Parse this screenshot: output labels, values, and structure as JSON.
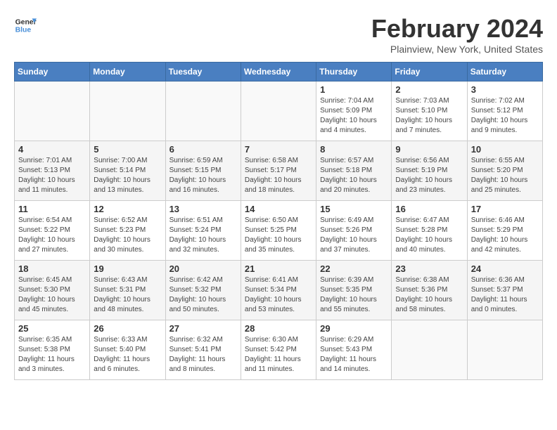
{
  "header": {
    "logo_line1": "General",
    "logo_line2": "Blue",
    "month_year": "February 2024",
    "location": "Plainview, New York, United States"
  },
  "days_of_week": [
    "Sunday",
    "Monday",
    "Tuesday",
    "Wednesday",
    "Thursday",
    "Friday",
    "Saturday"
  ],
  "weeks": [
    [
      {
        "num": "",
        "info": ""
      },
      {
        "num": "",
        "info": ""
      },
      {
        "num": "",
        "info": ""
      },
      {
        "num": "",
        "info": ""
      },
      {
        "num": "1",
        "info": "Sunrise: 7:04 AM\nSunset: 5:09 PM\nDaylight: 10 hours\nand 4 minutes."
      },
      {
        "num": "2",
        "info": "Sunrise: 7:03 AM\nSunset: 5:10 PM\nDaylight: 10 hours\nand 7 minutes."
      },
      {
        "num": "3",
        "info": "Sunrise: 7:02 AM\nSunset: 5:12 PM\nDaylight: 10 hours\nand 9 minutes."
      }
    ],
    [
      {
        "num": "4",
        "info": "Sunrise: 7:01 AM\nSunset: 5:13 PM\nDaylight: 10 hours\nand 11 minutes."
      },
      {
        "num": "5",
        "info": "Sunrise: 7:00 AM\nSunset: 5:14 PM\nDaylight: 10 hours\nand 13 minutes."
      },
      {
        "num": "6",
        "info": "Sunrise: 6:59 AM\nSunset: 5:15 PM\nDaylight: 10 hours\nand 16 minutes."
      },
      {
        "num": "7",
        "info": "Sunrise: 6:58 AM\nSunset: 5:17 PM\nDaylight: 10 hours\nand 18 minutes."
      },
      {
        "num": "8",
        "info": "Sunrise: 6:57 AM\nSunset: 5:18 PM\nDaylight: 10 hours\nand 20 minutes."
      },
      {
        "num": "9",
        "info": "Sunrise: 6:56 AM\nSunset: 5:19 PM\nDaylight: 10 hours\nand 23 minutes."
      },
      {
        "num": "10",
        "info": "Sunrise: 6:55 AM\nSunset: 5:20 PM\nDaylight: 10 hours\nand 25 minutes."
      }
    ],
    [
      {
        "num": "11",
        "info": "Sunrise: 6:54 AM\nSunset: 5:22 PM\nDaylight: 10 hours\nand 27 minutes."
      },
      {
        "num": "12",
        "info": "Sunrise: 6:52 AM\nSunset: 5:23 PM\nDaylight: 10 hours\nand 30 minutes."
      },
      {
        "num": "13",
        "info": "Sunrise: 6:51 AM\nSunset: 5:24 PM\nDaylight: 10 hours\nand 32 minutes."
      },
      {
        "num": "14",
        "info": "Sunrise: 6:50 AM\nSunset: 5:25 PM\nDaylight: 10 hours\nand 35 minutes."
      },
      {
        "num": "15",
        "info": "Sunrise: 6:49 AM\nSunset: 5:26 PM\nDaylight: 10 hours\nand 37 minutes."
      },
      {
        "num": "16",
        "info": "Sunrise: 6:47 AM\nSunset: 5:28 PM\nDaylight: 10 hours\nand 40 minutes."
      },
      {
        "num": "17",
        "info": "Sunrise: 6:46 AM\nSunset: 5:29 PM\nDaylight: 10 hours\nand 42 minutes."
      }
    ],
    [
      {
        "num": "18",
        "info": "Sunrise: 6:45 AM\nSunset: 5:30 PM\nDaylight: 10 hours\nand 45 minutes."
      },
      {
        "num": "19",
        "info": "Sunrise: 6:43 AM\nSunset: 5:31 PM\nDaylight: 10 hours\nand 48 minutes."
      },
      {
        "num": "20",
        "info": "Sunrise: 6:42 AM\nSunset: 5:32 PM\nDaylight: 10 hours\nand 50 minutes."
      },
      {
        "num": "21",
        "info": "Sunrise: 6:41 AM\nSunset: 5:34 PM\nDaylight: 10 hours\nand 53 minutes."
      },
      {
        "num": "22",
        "info": "Sunrise: 6:39 AM\nSunset: 5:35 PM\nDaylight: 10 hours\nand 55 minutes."
      },
      {
        "num": "23",
        "info": "Sunrise: 6:38 AM\nSunset: 5:36 PM\nDaylight: 10 hours\nand 58 minutes."
      },
      {
        "num": "24",
        "info": "Sunrise: 6:36 AM\nSunset: 5:37 PM\nDaylight: 11 hours\nand 0 minutes."
      }
    ],
    [
      {
        "num": "25",
        "info": "Sunrise: 6:35 AM\nSunset: 5:38 PM\nDaylight: 11 hours\nand 3 minutes."
      },
      {
        "num": "26",
        "info": "Sunrise: 6:33 AM\nSunset: 5:40 PM\nDaylight: 11 hours\nand 6 minutes."
      },
      {
        "num": "27",
        "info": "Sunrise: 6:32 AM\nSunset: 5:41 PM\nDaylight: 11 hours\nand 8 minutes."
      },
      {
        "num": "28",
        "info": "Sunrise: 6:30 AM\nSunset: 5:42 PM\nDaylight: 11 hours\nand 11 minutes."
      },
      {
        "num": "29",
        "info": "Sunrise: 6:29 AM\nSunset: 5:43 PM\nDaylight: 11 hours\nand 14 minutes."
      },
      {
        "num": "",
        "info": ""
      },
      {
        "num": "",
        "info": ""
      }
    ]
  ]
}
